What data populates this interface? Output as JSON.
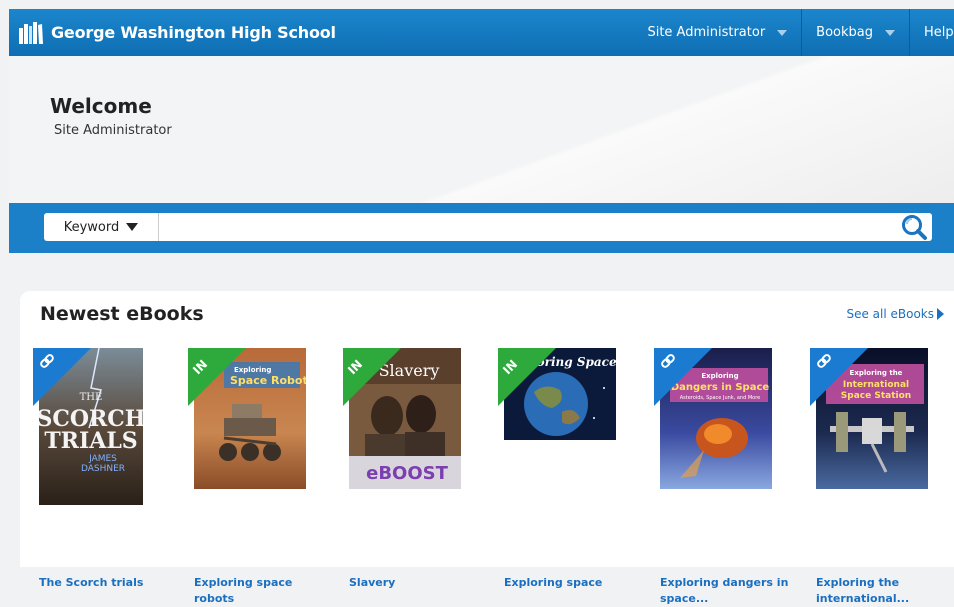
{
  "header": {
    "title": "George Washington High School",
    "nav": [
      {
        "label": "Site Administrator"
      },
      {
        "label": "Bookbag"
      },
      {
        "label": "Help"
      }
    ]
  },
  "welcome": {
    "title": "Welcome",
    "subtitle": "Site Administrator"
  },
  "search": {
    "type_label": "Keyword",
    "value": "",
    "placeholder": ""
  },
  "newest": {
    "title": "Newest eBooks",
    "see_all": "See all eBooks",
    "books": [
      {
        "title": "The Scorch trials",
        "badge": "link-icon",
        "cover_text": [
          "THE",
          "SCORCH",
          "TRIALS",
          "JAMES",
          "DASHNER"
        ]
      },
      {
        "title": "Exploring space robots",
        "badge": "IN",
        "cover_text": [
          "Exploring",
          "Space Robots"
        ]
      },
      {
        "title": "Slavery",
        "badge": "IN",
        "cover_text": [
          "Slavery",
          "eBOOST"
        ]
      },
      {
        "title": "Exploring space",
        "badge": "IN",
        "cover_text": [
          "Exploring Space"
        ]
      },
      {
        "title": "Exploring dangers in space...",
        "badge": "link-icon",
        "cover_text": [
          "Exploring",
          "Dangers in Space",
          "Asteroids, Space Junk, and More"
        ]
      },
      {
        "title": "Exploring the international...",
        "badge": "link-icon",
        "cover_text": [
          "Exploring the",
          "International",
          "Space Station"
        ]
      }
    ]
  },
  "colors": {
    "header": "#1580c8",
    "link": "#1b6fc0",
    "badge_blue": "#1a7bd0",
    "badge_green": "#2eaa3c"
  }
}
